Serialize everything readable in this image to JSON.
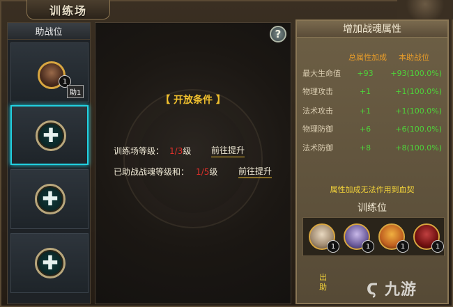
{
  "window": {
    "title": "训练场"
  },
  "assist": {
    "header": "助战位",
    "hero_badge": "1",
    "assist_tag": "助1"
  },
  "middle": {
    "help_label": "?",
    "title": "【 开放条件 】",
    "cond1": {
      "label": "训练场等级：",
      "current": "1",
      "sep": "/",
      "max": "3",
      "unit": "级",
      "link": "前往提升"
    },
    "cond2": {
      "label": "已助战战魂等级和：",
      "current": "1",
      "sep": "/",
      "max": "5",
      "unit": "级",
      "link": "前往提升"
    }
  },
  "right": {
    "title": "增加战魂属性",
    "col_total": "总属性加成",
    "col_own": "本助战位",
    "attrs": [
      {
        "name": "最大生命值",
        "total": "+93",
        "own": "+93(100.0%)"
      },
      {
        "name": "物理攻击",
        "total": "+1",
        "own": "+1(100.0%)"
      },
      {
        "name": "法术攻击",
        "total": "+1",
        "own": "+1(100.0%)"
      },
      {
        "name": "物理防御",
        "total": "+6",
        "own": "+6(100.0%)"
      },
      {
        "name": "法术防御",
        "total": "+8",
        "own": "+8(100.0%)"
      }
    ],
    "note": "属性加成无法作用到血契",
    "train_title": "训练位",
    "train_badges": [
      "1",
      "1",
      "1",
      "1"
    ],
    "bottom_text": [
      "出",
      "助"
    ]
  },
  "watermark": "九游",
  "colors": {
    "accent": "#f2c12e",
    "green": "#4ed43a",
    "red": "#e0302a",
    "cyan": "#22d0e0"
  }
}
